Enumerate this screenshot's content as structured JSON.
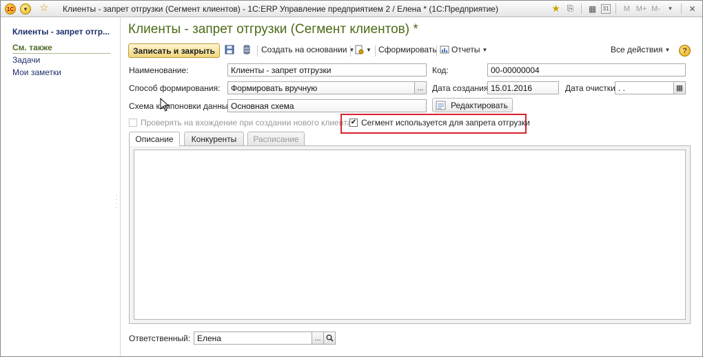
{
  "window": {
    "title": "Клиенты - запрет отгрузки (Сегмент клиентов) - 1С:ERP Управление предприятием 2 / Елена * (1С:Предприятие)",
    "logo_text": "1С"
  },
  "titlebar_icons": [
    "star-icon",
    "bookmark-icon",
    "calculator-icon",
    "calendar-icon"
  ],
  "titlebar_text_icons": {
    "m": "M",
    "m_plus": "M+",
    "m_minus": "M-",
    "calendar_day": "31"
  },
  "sidebar": {
    "title": "Клиенты - запрет отгр...",
    "section": "См. также",
    "links": [
      "Задачи",
      "Мои заметки"
    ]
  },
  "form": {
    "title": "Клиенты - запрет отгрузки (Сегмент клиентов) *",
    "toolbar": {
      "save_close": "Записать и закрыть",
      "create_based": "Создать на основании",
      "generate": "Сформировать",
      "reports": "Отчеты",
      "all_actions": "Все действия",
      "help": "?"
    },
    "fields": {
      "name_label": "Наименование:",
      "name_value": "Клиенты - запрет отгрузки",
      "code_label": "Код:",
      "code_value": "00-00000004",
      "method_label": "Способ формирования:",
      "method_value": "Формировать вручную",
      "created_label": "Дата создания:",
      "created_value": "15.01.2016",
      "cleared_label": "Дата очистки:",
      "cleared_value": " .  .",
      "schema_label": "Схема компоновки данных:",
      "schema_value": "Основная схема",
      "edit_button": "Редактировать",
      "check_new_client": "Проверять на вхождение при создании нового клиента",
      "segment_ban": "Сегмент используется для запрета отгрузки",
      "select_btn": "...",
      "responsible_label": "Ответственный:",
      "responsible_value": "Елена"
    },
    "checks": {
      "check_new_client": false,
      "segment_ban": true
    },
    "tabs": [
      "Описание",
      "Конкуренты",
      "Расписание"
    ]
  },
  "colors": {
    "title_green": "#4b6a16",
    "link_blue": "#1c2d6b",
    "highlight_red": "#d9202a",
    "primary_button": "#f0d67a"
  }
}
